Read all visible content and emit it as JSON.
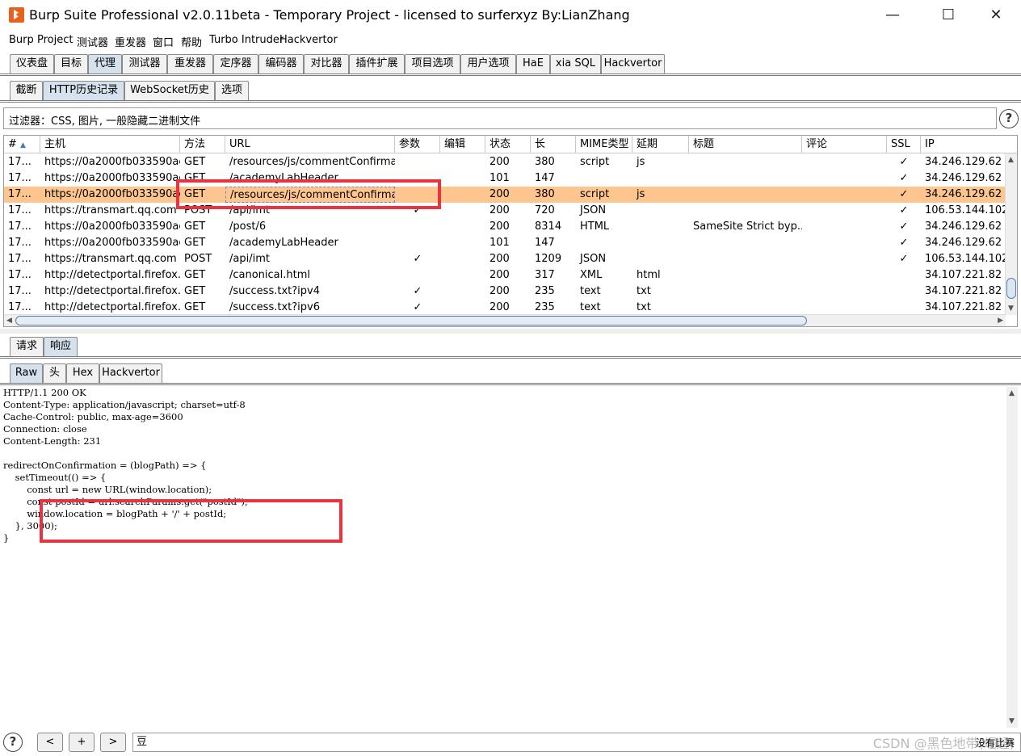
{
  "window": {
    "title": "Burp Suite Professional v2.0.11beta - Temporary Project - licensed to surferxyz By:LianZhang",
    "minimize": "—",
    "maximize": "☐",
    "close": "✕"
  },
  "menu": [
    "Burp",
    "Project",
    "测试器",
    "重发器",
    "窗口",
    "帮助",
    "Turbo Intruder",
    "Hackvertor"
  ],
  "main_tabs": [
    "仪表盘",
    "目标",
    "代理",
    "测试器",
    "重发器",
    "定序器",
    "编码器",
    "对比器",
    "插件扩展",
    "项目选项",
    "用户选项",
    "HaE",
    "xia SQL",
    "Hackvertor"
  ],
  "main_tab_active": "代理",
  "proxy_tabs": [
    "截断",
    "HTTP历史记录",
    "WebSocket历史",
    "选项"
  ],
  "filter": "过滤器：CSS, 图片, 一般隐藏二进制文件",
  "table": {
    "headers": [
      "#",
      "主机",
      "方法",
      "URL",
      "参数",
      "编辑",
      "状态",
      "长",
      "MIME类型",
      "延期",
      "标题",
      "评论",
      "SSL",
      "IP"
    ],
    "rows": [
      [
        "17...",
        "https://0a2000fb033590ae...",
        "GET",
        "/resources/js/commentConfirmat...",
        "",
        "",
        "200",
        "380",
        "script",
        "js",
        "",
        "",
        "✓",
        "34.246.129.62"
      ],
      [
        "17...",
        "https://0a2000fb033590ae...",
        "GET",
        "/academyLabHeader",
        "",
        "",
        "101",
        "147",
        "",
        "",
        "",
        "",
        "✓",
        "34.246.129.62"
      ],
      [
        "17...",
        "https://0a2000fb033590ae...",
        "GET",
        "/resources/js/commentConfirmat...",
        "",
        "",
        "200",
        "380",
        "script",
        "js",
        "",
        "",
        "✓",
        "34.246.129.62"
      ],
      [
        "17...",
        "https://transmart.qq.com",
        "POST",
        "/api/imt",
        "✓",
        "",
        "200",
        "720",
        "JSON",
        "",
        "",
        "",
        "✓",
        "106.53.144.102"
      ],
      [
        "17...",
        "https://0a2000fb033590ae...",
        "GET",
        "/post/6",
        "",
        "",
        "200",
        "8314",
        "HTML",
        "",
        "SameSite Strict byp...",
        "",
        "✓",
        "34.246.129.62"
      ],
      [
        "17...",
        "https://0a2000fb033590ae...",
        "GET",
        "/academyLabHeader",
        "",
        "",
        "101",
        "147",
        "",
        "",
        "",
        "",
        "✓",
        "34.246.129.62"
      ],
      [
        "17...",
        "https://transmart.qq.com",
        "POST",
        "/api/imt",
        "✓",
        "",
        "200",
        "1209",
        "JSON",
        "",
        "",
        "",
        "✓",
        "106.53.144.102"
      ],
      [
        "17...",
        "http://detectportal.firefox.c...",
        "GET",
        "/canonical.html",
        "",
        "",
        "200",
        "317",
        "XML",
        "html",
        "",
        "",
        "",
        "34.107.221.82"
      ],
      [
        "17...",
        "http://detectportal.firefox.c...",
        "GET",
        "/success.txt?ipv4",
        "✓",
        "",
        "200",
        "235",
        "text",
        "txt",
        "",
        "",
        "",
        "34.107.221.82"
      ],
      [
        "17...",
        "http://detectportal.firefox.c...",
        "GET",
        "/success.txt?ipv6",
        "✓",
        "",
        "200",
        "235",
        "text",
        "txt",
        "",
        "",
        "",
        "34.107.221.82"
      ]
    ],
    "selected_row": 2
  },
  "req_resp_tabs": [
    "请求",
    "响应"
  ],
  "req_resp_active": "响应",
  "view_tabs": [
    "Raw",
    "头",
    "Hex",
    "Hackvertor"
  ],
  "view_active": "Raw",
  "response_lines": [
    "HTTP/1.1 200 OK",
    "Content-Type: application/javascript; charset=utf-8",
    "Cache-Control: public, max-age=3600",
    "Connection: close",
    "Content-Length: 231",
    "",
    "redirectOnConfirmation = (blogPath) => {",
    "    setTimeout(() => {",
    "        const url = new URL(window.location);",
    "        const postId = url.searchParams.get(\"postId\");",
    "        window.location = blogPath + '/' + postId;",
    "    }, 3000);",
    "}"
  ],
  "bottom": {
    "help": "?",
    "prev": "<",
    "add": "+",
    "next": ">",
    "search_value": "豆",
    "match_status": "没有比赛",
    "watermark": "CSDN @黑色地带(崛起)"
  },
  "colors": {
    "selected_row": "#ffc58f",
    "active_tab": "#d6e1ee",
    "highlight_box": "#e8343e",
    "brand_icon": "#e8621d"
  }
}
